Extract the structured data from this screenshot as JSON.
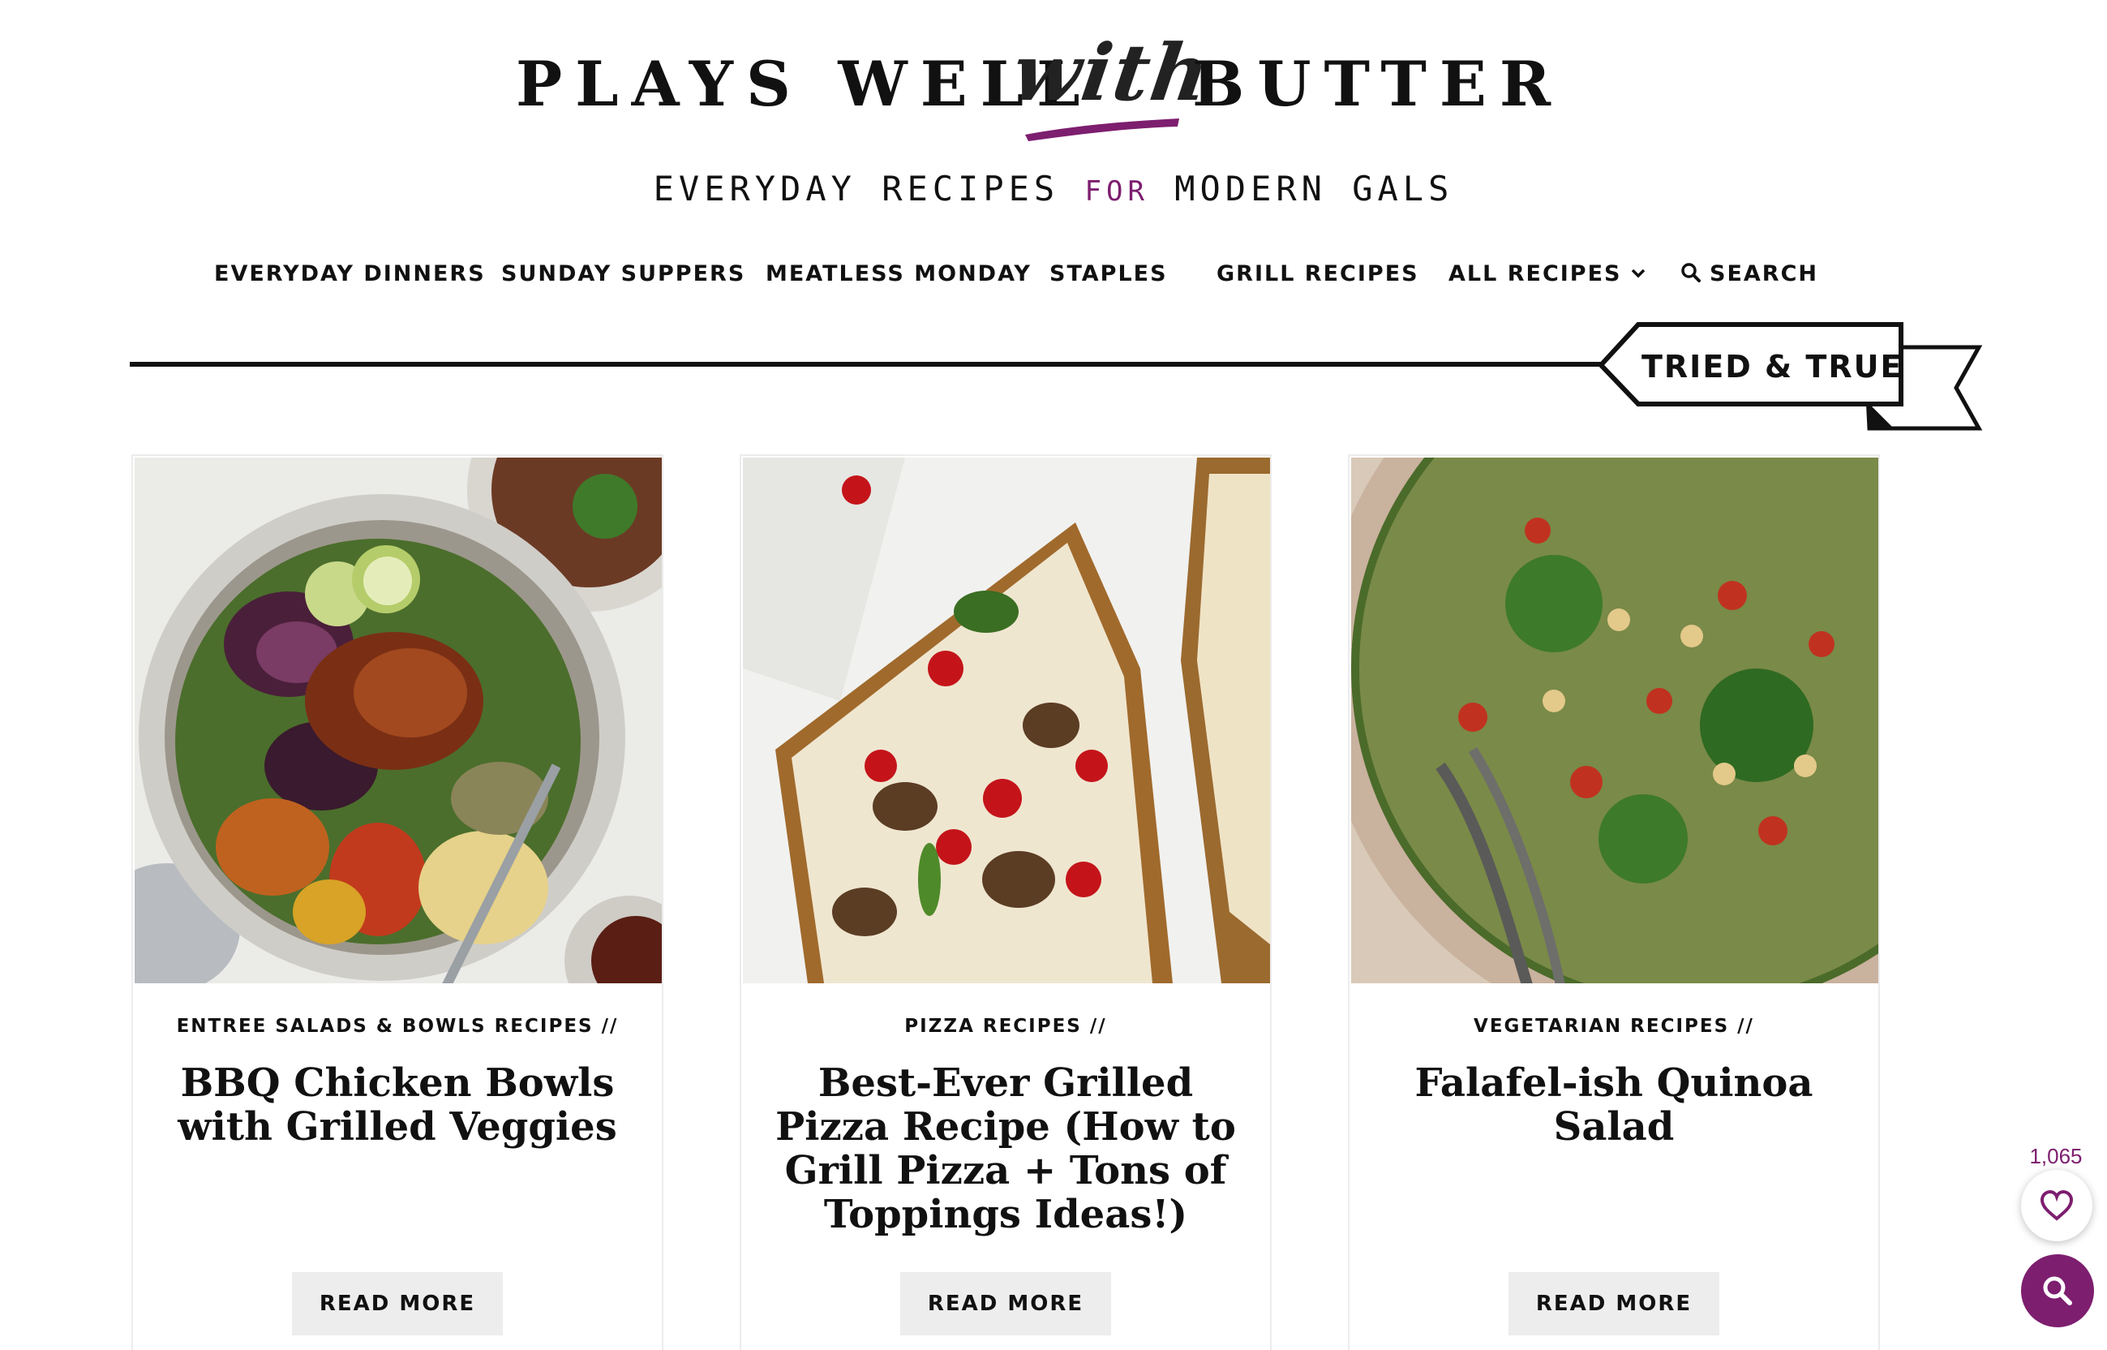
{
  "brand": {
    "logo_left": "PLAYS WELL",
    "logo_with": "with",
    "logo_right": "BUTTER",
    "tagline_part1": "EVERYDAY RECIPES",
    "tagline_for": "FOR",
    "tagline_part2": "MODERN GALS",
    "accent_color": "#7d1e6f"
  },
  "nav": {
    "items": [
      {
        "label": "EVERYDAY DINNERS"
      },
      {
        "label": "SUNDAY SUPPERS"
      },
      {
        "label": "MEATLESS MONDAY"
      },
      {
        "label": "STAPLES"
      },
      {
        "label": "GRILL RECIPES"
      },
      {
        "label": "ALL RECIPES",
        "icon": "chevron-down-icon"
      },
      {
        "label": "SEARCH",
        "icon": "search-icon"
      }
    ]
  },
  "section": {
    "title": "TRIED & TRUE"
  },
  "cards": [
    {
      "category": "ENTREE SALADS & BOWLS RECIPES //",
      "title": "BBQ Chicken Bowls with Grilled Veggies",
      "button": "READ MORE",
      "image": "bbq-chicken-bowl-photo"
    },
    {
      "category": "PIZZA RECIPES //",
      "title": "Best-Ever Grilled Pizza Recipe (How to Grill Pizza + Tons of Toppings Ideas!)",
      "button": "READ MORE",
      "image": "grilled-pizza-photo"
    },
    {
      "category": "VEGETARIAN RECIPES //",
      "title": "Falafel-ish Quinoa Salad",
      "button": "READ MORE",
      "image": "quinoa-salad-photo"
    }
  ],
  "widgets": {
    "favorite_count": "1,065",
    "favorite_icon": "heart-icon",
    "search_icon": "search-icon"
  }
}
